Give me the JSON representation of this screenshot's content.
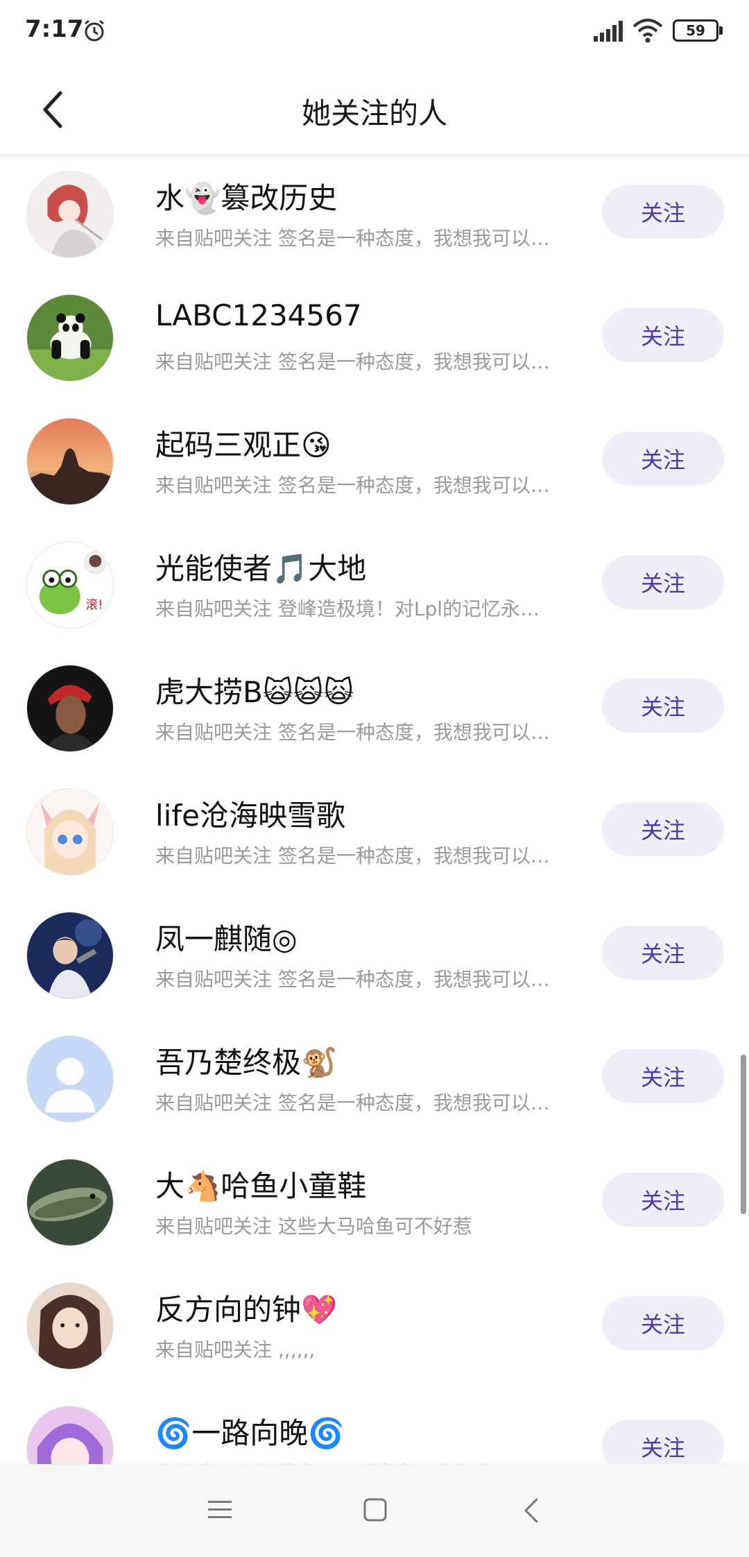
{
  "status_bar": {
    "time": "7:17",
    "battery": "59"
  },
  "header": {
    "title": "她关注的人"
  },
  "follow_label": "关注",
  "users": [
    {
      "name": "水👻篡改历史",
      "desc": "来自贴吧关注 签名是一种态度，我想我可以…"
    },
    {
      "name": "LABC1234567",
      "desc": "来自贴吧关注 签名是一种态度，我想我可以…"
    },
    {
      "name": "起码三观正😘",
      "desc": "来自贴吧关注 签名是一种态度，我想我可以…"
    },
    {
      "name": "光能使者🎵大地",
      "desc": "来自贴吧关注 登峰造极境！对Lpl的记忆永…"
    },
    {
      "name": "虎大捞B🙀🙀🙀",
      "desc": "来自贴吧关注 签名是一种态度，我想我可以…"
    },
    {
      "name": "life沧海映雪歌",
      "desc": "来自贴吧关注 签名是一种态度，我想我可以…"
    },
    {
      "name": "凤一麒随◎",
      "desc": "来自贴吧关注 签名是一种态度，我想我可以…"
    },
    {
      "name": "吾乃楚终极🐒",
      "desc": "来自贴吧关注 签名是一种态度，我想我可以…"
    },
    {
      "name": "大🐴哈鱼小童鞋",
      "desc": "来自贴吧关注 这些大马哈鱼可不好惹"
    },
    {
      "name": "反方向的钟💖",
      "desc": "来自贴吧关注 ,,,,,,"
    },
    {
      "name": "🌀一路向晚🌀",
      "desc": "来自贴吧关注 签名是一种态度，我想我可以…"
    }
  ]
}
